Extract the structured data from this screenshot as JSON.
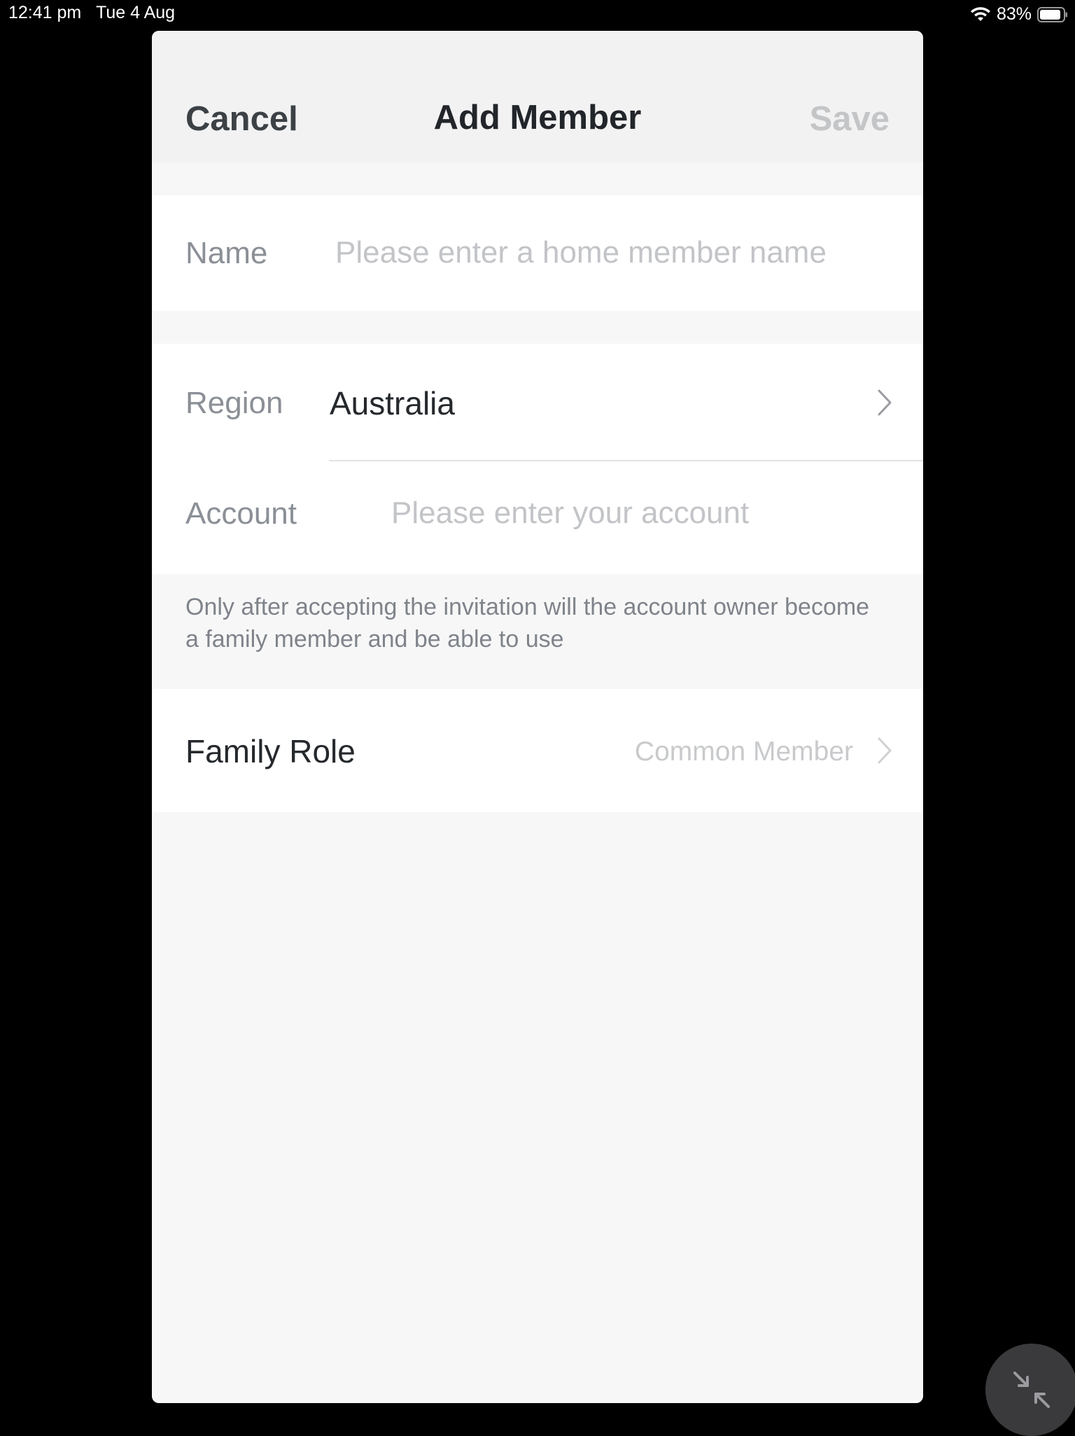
{
  "status_bar": {
    "time": "12:41 pm",
    "date": "Tue 4 Aug",
    "battery_percent": "83%",
    "wifi_icon": "wifi-icon",
    "battery_icon": "battery-icon"
  },
  "nav": {
    "cancel_label": "Cancel",
    "title": "Add Member",
    "save_label": "Save"
  },
  "form": {
    "name": {
      "label": "Name",
      "value": "",
      "placeholder": "Please enter a home member name"
    },
    "region": {
      "label": "Region",
      "value": "Australia",
      "icon": "chevron-right-icon"
    },
    "account": {
      "label": "Account",
      "value": "",
      "placeholder": "Please enter your account"
    },
    "info_text": "Only after accepting the invitation will the account owner become a family member and be able to use",
    "family_role": {
      "label": "Family Role",
      "value": "Common Member",
      "icon": "chevron-right-icon"
    }
  },
  "floating_button": {
    "icon": "collapse-arrows-icon"
  },
  "colors": {
    "background": "#000000",
    "sheet_background": "#f7f7f7",
    "nav_background": "#f2f2f2",
    "text_primary": "#25282c",
    "text_secondary": "#8b8f96",
    "placeholder": "#c3c4c7",
    "disabled": "#c4c5c7"
  }
}
